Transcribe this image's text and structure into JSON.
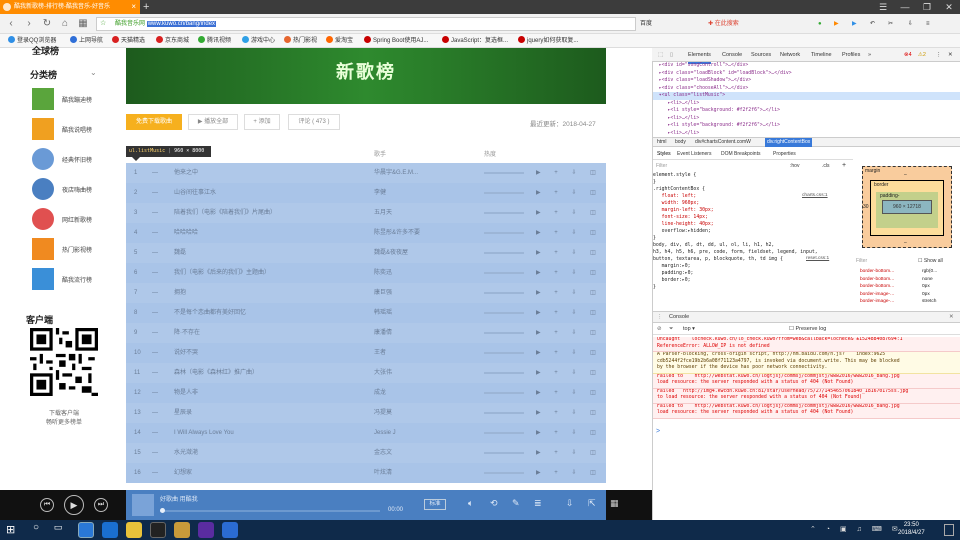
{
  "browser": {
    "tab_title": "酷我新歌榜-排行榜-酷我音乐-好音乐",
    "new_tab": "+",
    "site_label": "酷我音乐网",
    "url": "www.kuwo.cn/bang/index",
    "search_engine": "百度",
    "search_placeholder": "在此搜索",
    "win_buttons": [
      "☰",
      "—",
      "❐",
      "✕"
    ]
  },
  "bookmarks": [
    {
      "label": "登录QQ浏览器",
      "color": "#2f8fe6"
    },
    {
      "label": "上网导航",
      "color": "#2f6fd8"
    },
    {
      "label": "天猫精选",
      "color": "#d82020"
    },
    {
      "label": "京东商城",
      "color": "#d82020"
    },
    {
      "label": "腾讯视频",
      "color": "#33aa33"
    },
    {
      "label": "游戏中心",
      "color": "#2fa0e6"
    },
    {
      "label": "热门影视",
      "color": "#e6662f"
    },
    {
      "label": "爱淘宝",
      "color": "#ff6600"
    },
    {
      "label": "Spring Boot使用AJ...",
      "color": "#c80000"
    },
    {
      "label": "JavaScript：复选框...",
      "color": "#c80000"
    },
    {
      "label": "jquery如何获取复...",
      "color": "#c80000"
    }
  ],
  "sidebar": {
    "top_partial": "全球榜",
    "section_title": "分类榜",
    "items": [
      {
        "label": "酷我蹦迪榜",
        "color": "#5aa53c"
      },
      {
        "label": "酷我说唱榜",
        "color": "#f0a020"
      },
      {
        "label": "经典怀旧榜",
        "color": "#4a7fc1"
      },
      {
        "label": "夜店嗨曲榜",
        "color": "#4a7fc1"
      },
      {
        "label": "网红新歌榜",
        "color": "#e05050"
      },
      {
        "label": "热门影视榜",
        "color": "#f08a20"
      },
      {
        "label": "酷我流行榜",
        "color": "#3a8fd8"
      }
    ],
    "client_title": "客户端",
    "client_line1": "下载客户端",
    "client_line2": "畅听更多榜单"
  },
  "main": {
    "banner_text": "新歌榜",
    "buttons": [
      "免费下载歌曲",
      "▶ 播放全部",
      "+ 添加",
      "评论 ( 473 )"
    ],
    "update": "最近更新：2018-04-27",
    "tooltip_tag": "ul.listMusic",
    "tooltip_dim": "960 × 8000",
    "col_artist": "歌手",
    "col_hot": "热度",
    "songs": [
      {
        "num": "1",
        "title": "他来之中",
        "artist": "华晨宇&G.E.M..."
      },
      {
        "num": "2",
        "title": "山谷间往事江水",
        "artist": "李健"
      },
      {
        "num": "3",
        "title": "陪着我们（电影《陪着我们》片尾曲）",
        "artist": "五月天"
      },
      {
        "num": "4",
        "title": "哈哈哈哈",
        "artist": "陈昱彤&许多不要"
      },
      {
        "num": "5",
        "title": "魏磊",
        "artist": "魏磊&夜夜屋"
      },
      {
        "num": "6",
        "title": "我们（电影《后来的我们》主题曲）",
        "artist": "陈奕迅"
      },
      {
        "num": "7",
        "title": "拥抱",
        "artist": "康巨强"
      },
      {
        "num": "8",
        "title": "不是每个恋曲都有美好回忆",
        "artist": "韩瑶瑶"
      },
      {
        "num": "9",
        "title": "降·不存在",
        "artist": "康潘倩"
      },
      {
        "num": "10",
        "title": "说好不哭",
        "artist": "王者"
      },
      {
        "num": "11",
        "title": "森林（电影《森林红》推广曲）",
        "artist": "大张伟"
      },
      {
        "num": "12",
        "title": "物是人非",
        "artist": "成龙"
      },
      {
        "num": "13",
        "title": "星辰录",
        "artist": "冯提莫"
      },
      {
        "num": "14",
        "title": "I Will Always Love You",
        "artist": "Jessie J"
      },
      {
        "num": "15",
        "title": "水光潋滟",
        "artist": "金志文"
      },
      {
        "num": "16",
        "title": "幻想家",
        "artist": "叶炫清"
      }
    ],
    "row_actions": "▶ + ⇩ ◫"
  },
  "player": {
    "track": "好歌曲 用酷我",
    "time": "00:00",
    "quality": "标准",
    "progress": 0.0
  },
  "devtools": {
    "tabs": [
      "Elements",
      "Console",
      "Sources",
      "Network",
      "Timeline",
      "Profiles",
      "»"
    ],
    "errors": "⊗4",
    "warnings": "⚠2",
    "elements_lines": [
      "  ▸<div id=\"songControll\">…</div>",
      "  ▸<div class=\"loadBlock\" id=\"loadBlock\">…</div>",
      "  ▸<div class=\"loadShadow\">…</div>",
      "  ▸<div class=\"chooseAll\">…</div>",
      "  ▾<ul class=\"listMusic\">",
      "     ▸<li>…</li>",
      "     ▸<li style=\"background: #f2f2f6\">…</li>",
      "     ▸<li>…</li>",
      "     ▸<li style=\"background: #f2f2f6\">…</li>",
      "     ▸<li>…</li>"
    ],
    "crumbs": [
      "html",
      "body",
      "div#chartsContent.comW",
      "div.rightContentBox"
    ],
    "subtabs": [
      "Styles",
      "Event Listeners",
      "DOM Breakpoints",
      "Properties"
    ],
    "filter": "Filter",
    "hov": ":hov",
    "cls": ".cls",
    "style_lines": [
      "element.style {",
      "}",
      ".rightContentBox {",
      "   float: left;",
      "   width: 960px;",
      "   margin-left: 30px;",
      "   font-size: 14px;",
      "   line-height: 40px;",
      "   overflow:▸hidden;",
      "}",
      "body, div, dl, dt, dd, ul, ol, li, h1, h2,",
      "h3, h4, h5, h6, pre, code, form, fieldset, legend, input,",
      "button, textarea, p, blockquote, th, td img {",
      "   margin:▸0;",
      "   padding:▸0;",
      "   border:▸0;",
      "}"
    ],
    "style_source1": "charts.css:1",
    "style_source2": "reset.css:1",
    "box": {
      "margin": "margin",
      "border": "border",
      "padding": "padding-",
      "content": "960 × 12718",
      "left_val": "30",
      "dash": "–"
    },
    "computed_filter": "Filter",
    "show_all": "Show all",
    "computed": [
      {
        "prop": "border-bottom...",
        "val": "rgb(0..."
      },
      {
        "prop": "border-bottom...",
        "val": "none"
      },
      {
        "prop": "border-bottom...",
        "val": "0px"
      },
      {
        "prop": "border-image-...",
        "val": "0px"
      },
      {
        "prop": "border-image-...",
        "val": "stretch"
      }
    ],
    "console_tab": "Console",
    "console_context": "top",
    "preserve_log": "Preserve log",
    "messages": [
      {
        "type": "err",
        "text": "Uncaught    locheck.kuwo.cn/lo_check.kuwo?from=web&callback=locheck& ±1524884087694:1\nReferenceError: ALLOW_IP is not defined"
      },
      {
        "type": "warn",
        "text": "A Parser-blocking, cross-origin script, http://hm.baidu.com/h.js?    index:9625\ncdb5244f2fce19b2b6a08f71123a4797, is invoked via document.write. This may be blocked\nby the browser if the device has poor network connectivity."
      },
      {
        "type": "err",
        "text": "Failed to    http://webstat.kuwo.cn/logtjsj/commsj/commjstj/www2016/www2016_bang.jpg\nload resource: the server responded with a status of 404 (Not Found)"
      },
      {
        "type": "err",
        "text": "Failed   http://img4.kwcdn.kuwo.cn:81/star/userhead/75/27/1454657061840_181670175ss.jpg\nto load resource: the server responded with a status of 404 (Not Found)"
      },
      {
        "type": "err",
        "text": "Failed to    http://webstat.kuwo.cn/logtjsj/commsj/commjstj/www2016/www2016_bang.jpg\nload resource: the server responded with a status of 404 (Not Found)"
      }
    ],
    "prompt": ">"
  },
  "taskbar": {
    "time": "23:50",
    "date": "2018/4/27"
  }
}
